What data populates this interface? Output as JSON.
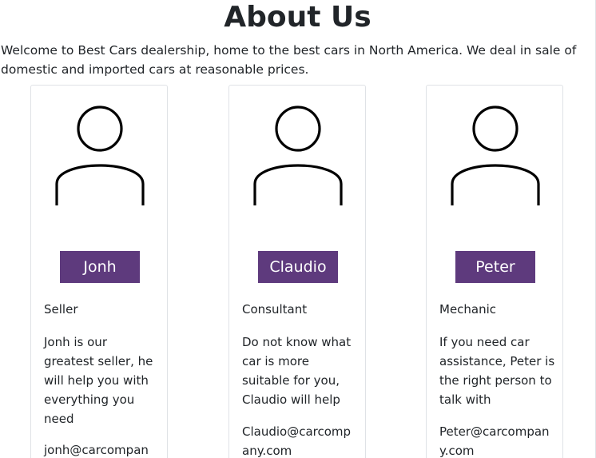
{
  "page": {
    "title": "About Us",
    "intro": "Welcome to Best Cars dealership, home to the best cars in North America. We deal in sale of domestic and imported cars at reasonable prices."
  },
  "team": [
    {
      "name": "Jonh",
      "role": "Seller",
      "description": "Jonh is our greatest seller, he will help you with everything you need",
      "email": "jonh@carcompany.com",
      "avatar_icon": "person-icon"
    },
    {
      "name": "Claudio",
      "role": "Consultant",
      "description": "Do not know what car is more suitable for you, Claudio will help",
      "email": "Claudio@carcompany.com",
      "avatar_icon": "person-icon"
    },
    {
      "name": "Peter",
      "role": "Mechanic",
      "description": "If you need car assistance, Peter is the right person to talk with",
      "email": "Peter@carcompany.com",
      "avatar_icon": "person-icon"
    }
  ],
  "colors": {
    "name_button_bg": "#5e3a7d",
    "name_button_text": "#ffffff",
    "text": "#212529",
    "card_border": "#dfe2e6"
  }
}
